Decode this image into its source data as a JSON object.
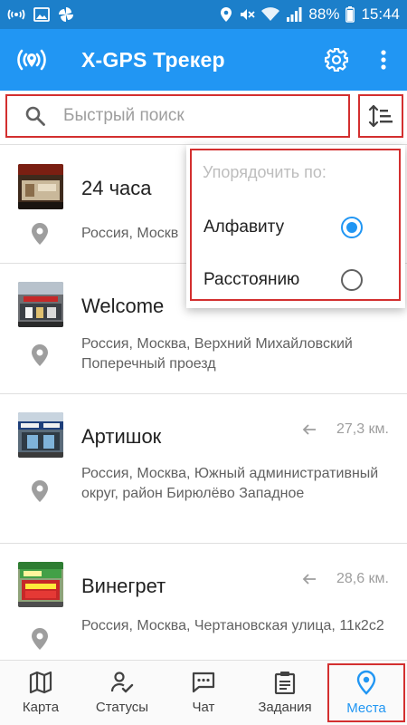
{
  "status_bar": {
    "battery": "88%",
    "time": "15:44"
  },
  "app_bar": {
    "title": "X-GPS Трекер"
  },
  "search": {
    "placeholder": "Быстрый поиск"
  },
  "sort_menu": {
    "header": "Упорядочить по:",
    "options": [
      {
        "label": "Алфавиту",
        "selected": true
      },
      {
        "label": "Расстоянию",
        "selected": false
      }
    ]
  },
  "places": [
    {
      "name": "24 часа",
      "address": "Россия, Москв",
      "distance": ""
    },
    {
      "name": "Welcome",
      "address": "Россия, Москва, Верхний Михайловский Поперечный проезд",
      "distance": ""
    },
    {
      "name": "Артишок",
      "address": "Россия, Москва, Южный административный округ, район Бирюлёво Западное",
      "distance": "27,3 км."
    },
    {
      "name": "Винегрет",
      "address": "Россия, Москва, Чертановская улица, 11к2с2",
      "distance": "28,6 км."
    }
  ],
  "bottom_nav": {
    "items": [
      {
        "label": "Карта",
        "icon": "map-icon"
      },
      {
        "label": "Статусы",
        "icon": "statuses-icon"
      },
      {
        "label": "Чат",
        "icon": "chat-icon"
      },
      {
        "label": "Задания",
        "icon": "tasks-icon"
      },
      {
        "label": "Места",
        "icon": "place-pin-icon"
      }
    ],
    "active": 4
  },
  "colors": {
    "primary": "#2196f3",
    "status_bar": "#1c7fca",
    "highlight_frame": "#d32f2f"
  }
}
